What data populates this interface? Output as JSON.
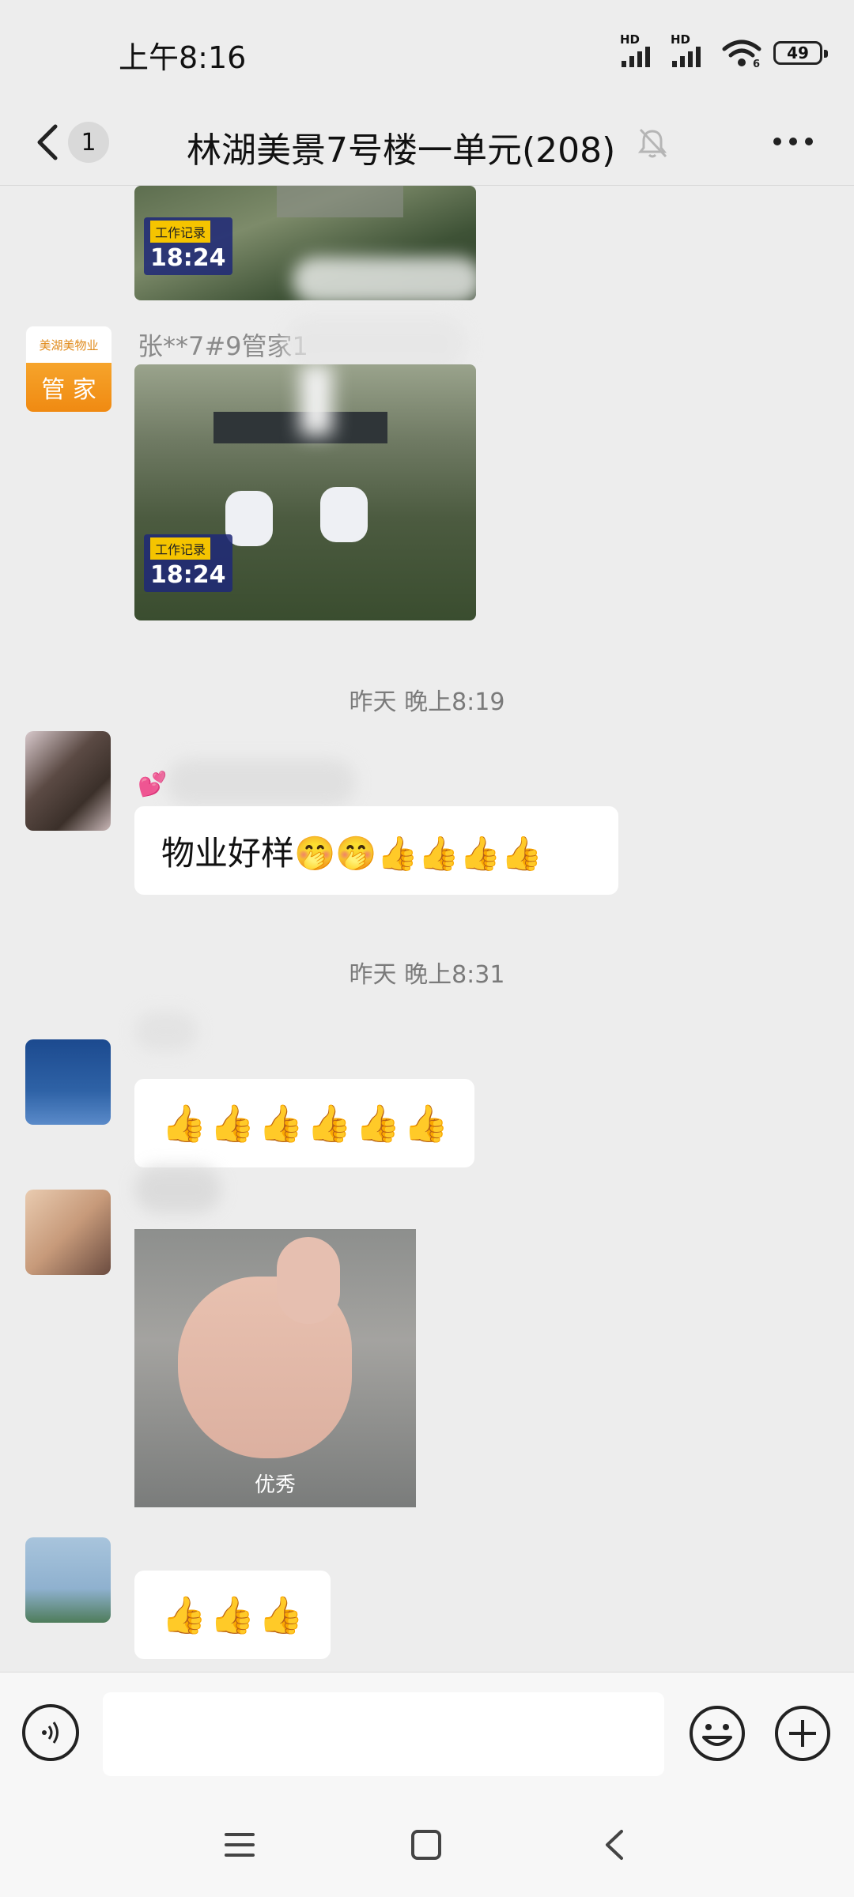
{
  "status_bar": {
    "time": "上午8:16",
    "sim1_label": "HD",
    "sim2_label": "HD",
    "wifi_label": "6",
    "battery": "49"
  },
  "header": {
    "back_icon": "chevron-left-icon",
    "unread_count": "1",
    "title": "林湖美景7号楼一单元(208)",
    "mute_icon": "bell-off-icon",
    "more_icon": "more-dots-icon"
  },
  "messages": {
    "photo_stamp_tag": "工作记录",
    "photo_stamp_time": "18:24",
    "manager_avatar_brand": "美湖美物业",
    "manager_avatar_role": "管 家",
    "manager_sender": "张**7#9管家1",
    "timestamp_1": "昨天 晚上8:19",
    "text_message": "物业好样🤭🤭👍👍👍👍",
    "sparkle_emoji": "💕",
    "timestamp_2": "昨天 晚上8:31",
    "thumbs_message_1": "👍👍👍👍👍👍",
    "sticker_caption": "优秀",
    "thumbs_message_2": "👍👍👍"
  },
  "input_bar": {
    "voice_icon": "voice-icon",
    "input_value": "",
    "sticker_icon": "smiley-icon",
    "plus_icon": "plus-circle-icon"
  },
  "system_nav": {
    "menu_icon": "menu-icon",
    "home_icon": "home-square-icon",
    "back_icon": "triangle-back-icon"
  }
}
